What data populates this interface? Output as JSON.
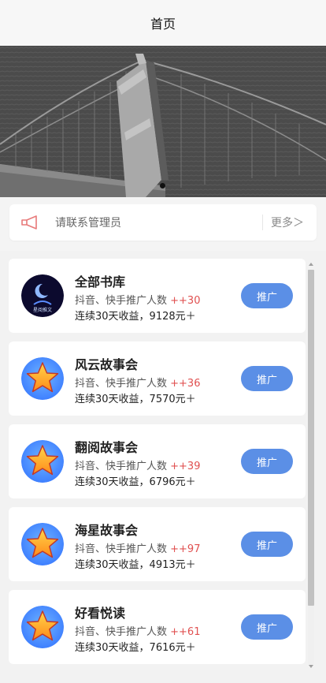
{
  "navbar": {
    "title": "首页"
  },
  "banner": {
    "image": "golden-gate-bridge-tower-grayscale",
    "active_slide": 1
  },
  "notice": {
    "icon": "speaker-icon",
    "text": "请联系管理员",
    "more_label": "更多＞"
  },
  "colors": {
    "button": "#5b8fe6",
    "highlight_number": "#e05050",
    "speaker": "#e87a7a"
  },
  "books": [
    {
      "name": "全部书库",
      "platforms": "抖音、快手推广人数 ",
      "count": "++30",
      "earnings": "连续30天收益，9128元＋",
      "button": "推广",
      "avatar": "logo-avatar",
      "logo_text": "星阅推文"
    },
    {
      "name": "风云故事会",
      "platforms": "抖音、快手推广人数 ",
      "count": "++36",
      "earnings": "连续30天收益，7570元＋",
      "button": "推广",
      "avatar": "star-icon"
    },
    {
      "name": "翻阅故事会",
      "platforms": "抖音、快手推广人数 ",
      "count": "++39",
      "earnings": "连续30天收益，6796元＋",
      "button": "推广",
      "avatar": "star-icon"
    },
    {
      "name": "海星故事会",
      "platforms": "抖音、快手推广人数 ",
      "count": "++97",
      "earnings": "连续30天收益，4913元＋",
      "button": "推广",
      "avatar": "star-icon"
    },
    {
      "name": "好看悦读",
      "platforms": "抖音、快手推广人数 ",
      "count": "++61",
      "earnings": "连续30天收益，7616元＋",
      "button": "推广",
      "avatar": "star-icon"
    }
  ]
}
